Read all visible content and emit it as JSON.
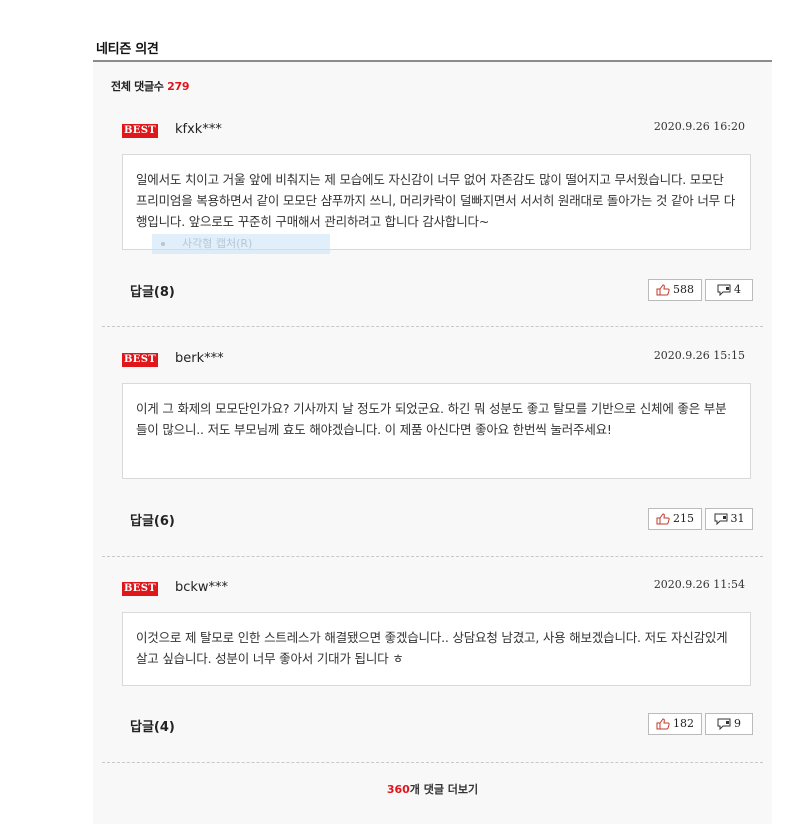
{
  "section": {
    "title": "네티즌 의견"
  },
  "total": {
    "label": "전체 댓글수",
    "count": "279"
  },
  "comments": [
    {
      "badge": "BEST",
      "user": "kfxk***",
      "date": "2020.9.26 16:20",
      "text": "일에서도 치이고 거울 앞에 비춰지는 제 모습에도 자신감이 너무 없어 자존감도 많이 떨어지고 무서웠습니다. 모모단 프리미엄을 복용하면서 같이 모모단 샴푸까지 쓰니, 머리카락이 덜빠지면서 서서히 원래대로 돌아가는 것 같아 너무 다행입니다. 앞으로도 꾸준히 구매해서 관리하려고 합니다 감사합니다~",
      "reply": "답글(8)",
      "likes": "588",
      "dislikes": "4"
    },
    {
      "badge": "BEST",
      "user": "berk***",
      "date": "2020.9.26 15:15",
      "text": "이게 그 화제의 모모단인가요? 기사까지 날 정도가 되었군요. 하긴 뭐 성분도 좋고 탈모를 기반으로 신체에 좋은 부분들이 많으니.. 저도 부모님께 효도 해야겠습니다. 이 제품 아신다면 좋아요 한번씩 눌러주세요!",
      "reply": "답글(6)",
      "likes": "215",
      "dislikes": "31"
    },
    {
      "badge": "BEST",
      "user": "bckw***",
      "date": "2020.9.26 11:54",
      "text": "이것으로 제 탈모로 인한 스트레스가 해결됐으면 좋겠습니다.. 상담요청 남겼고, 사용 해보겠습니다. 저도 자신감있게 살고 싶습니다. 성분이 너무 좋아서 기대가 됩니다 ㅎ",
      "reply": "답글(4)",
      "likes": "182",
      "dislikes": "9"
    }
  ],
  "more": {
    "count": "360",
    "label": "개 댓글 더보기"
  },
  "overlay": {
    "text": "사각형 캡처(R)"
  },
  "colors": {
    "accent": "#e0161b",
    "panel": "#f8f8f8",
    "border": "#d9d9d9"
  },
  "icons": {
    "like": "thumbs-up-icon",
    "dislike": "speech-bubble-icon"
  }
}
